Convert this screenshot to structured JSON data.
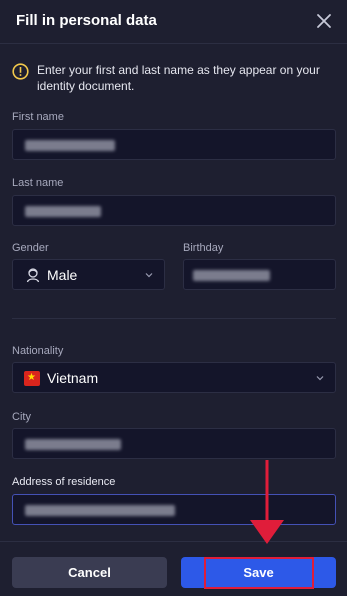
{
  "dialog": {
    "title": "Fill in personal data",
    "notice": "Enter your first and last name as they appear on your identity document."
  },
  "form": {
    "first_name_label": "First name",
    "last_name_label": "Last name",
    "gender_label": "Gender",
    "gender_value": "Male",
    "birthday_label": "Birthday",
    "nationality_label": "Nationality",
    "nationality_value": "Vietnam",
    "city_label": "City",
    "address_label": "Address of residence"
  },
  "actions": {
    "cancel_label": "Cancel",
    "save_label": "Save"
  },
  "colors": {
    "background": "#1e1f30",
    "field": "#14152a",
    "primary": "#2d59e8",
    "highlight": "#e01d3a",
    "warning": "#f2c94c"
  },
  "icons": {
    "close": "close-icon",
    "warning": "warning-circle-icon",
    "gender": "person-icon",
    "select": "chevron-down-icon",
    "flag": "vietnam-flag-icon"
  }
}
